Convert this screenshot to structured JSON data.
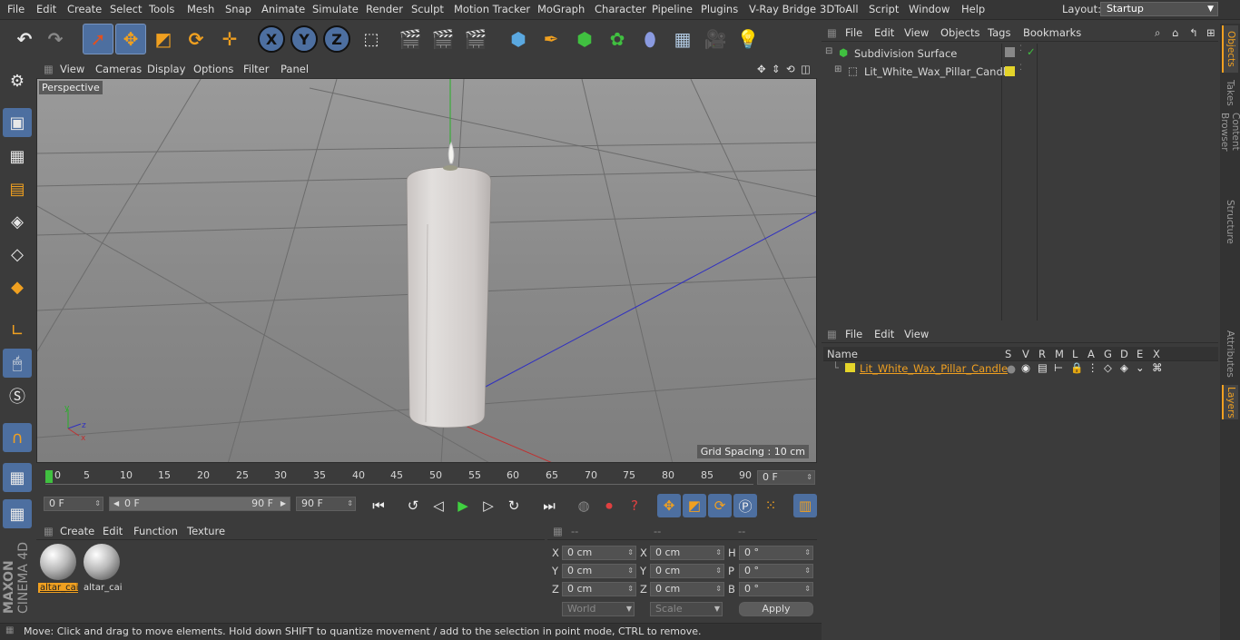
{
  "menubar": {
    "items": [
      "File",
      "Edit",
      "Create",
      "Select",
      "Tools",
      "Mesh",
      "Snap",
      "Animate",
      "Simulate",
      "Render",
      "Sculpt",
      "Motion Tracker",
      "MoGraph",
      "Character",
      "Pipeline",
      "Plugins",
      "V-Ray Bridge",
      "3DToAll",
      "Script",
      "Window",
      "Help"
    ],
    "layout_label": "Layout:",
    "layout_value": "Startup"
  },
  "toolbar": {
    "x_label": "X",
    "y_label": "Y",
    "z_label": "Z"
  },
  "viewport": {
    "menu": [
      "View",
      "Cameras",
      "Display",
      "Options",
      "Filter",
      "Panel"
    ],
    "camera_label": "Perspective",
    "grid_spacing": "Grid Spacing : 10 cm"
  },
  "timeline": {
    "ticks": [
      "0",
      "5",
      "10",
      "15",
      "20",
      "25",
      "30",
      "35",
      "40",
      "45",
      "50",
      "55",
      "60",
      "65",
      "70",
      "75",
      "80",
      "85",
      "90"
    ],
    "current_frame": "0 F"
  },
  "anim": {
    "start_field": "0 F",
    "range_start": "0 F",
    "range_end": "90 F",
    "end_field": "90 F"
  },
  "materials": {
    "menu": [
      "Create",
      "Edit",
      "Function",
      "Texture"
    ],
    "items": [
      {
        "name": "altar_cai",
        "selected": true
      },
      {
        "name": "altar_cai",
        "selected": false
      }
    ]
  },
  "coords": {
    "headers": [
      "--",
      "--",
      "--"
    ],
    "rows": [
      {
        "a_label": "X",
        "a_val": "0 cm",
        "b_label": "X",
        "b_val": "0 cm",
        "c_label": "H",
        "c_val": "0 °"
      },
      {
        "a_label": "Y",
        "a_val": "0 cm",
        "b_label": "Y",
        "b_val": "0 cm",
        "c_label": "P",
        "c_val": "0 °"
      },
      {
        "a_label": "Z",
        "a_val": "0 cm",
        "b_label": "Z",
        "b_val": "0 cm",
        "c_label": "B",
        "c_val": "0 °"
      }
    ],
    "world": "World",
    "scale": "Scale",
    "apply": "Apply"
  },
  "status": "Move: Click and drag to move elements. Hold down SHIFT to quantize movement / add to the selection in point mode, CTRL to remove.",
  "objects": {
    "menu": [
      "File",
      "Edit",
      "View",
      "Objects",
      "Tags",
      "Bookmarks"
    ],
    "items": [
      {
        "name": "Subdivision Surface"
      },
      {
        "name": "Lit_White_Wax_Pillar_Candle"
      }
    ]
  },
  "layers": {
    "menu": [
      "File",
      "Edit",
      "View"
    ],
    "col_name": "Name",
    "cols": [
      "S",
      "V",
      "R",
      "M",
      "L",
      "A",
      "G",
      "D",
      "E",
      "X"
    ],
    "items": [
      {
        "name": "Lit_White_Wax_Pillar_Candle"
      }
    ]
  },
  "sidetabs": [
    "Objects",
    "Takes",
    "Content Browser",
    "Structure",
    "Attributes",
    "Layers"
  ],
  "colors": {
    "accent_blue": "#4d6fa0",
    "layer_yellow": "#e4d42a",
    "orange_text": "#f0a020"
  }
}
